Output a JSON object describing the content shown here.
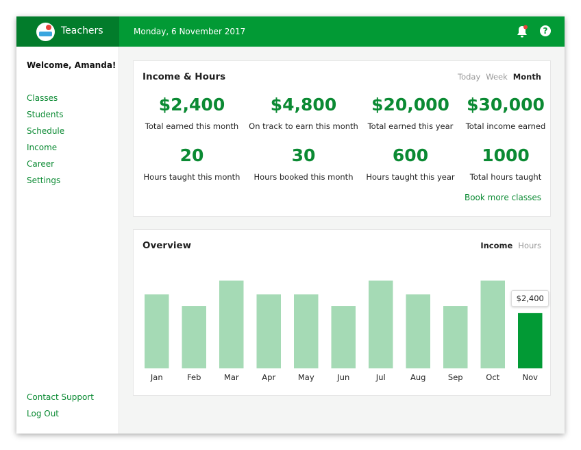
{
  "app": {
    "title": "Teachers",
    "date": "Monday, 6 November 2017"
  },
  "icons": {
    "bell": "bell-icon",
    "help": "help-icon",
    "logo": "logo-icon"
  },
  "colors": {
    "brand_dark": "#027c2b",
    "brand": "#029a35",
    "accent_text": "#0b8a33",
    "bar_light": "#a5dab5",
    "bar_active": "#029a35"
  },
  "help_glyph": "?",
  "sidebar": {
    "welcome": "Welcome, Amanda!",
    "items": [
      {
        "label": "Classes"
      },
      {
        "label": "Students"
      },
      {
        "label": "Schedule"
      },
      {
        "label": "Income"
      },
      {
        "label": "Career"
      },
      {
        "label": "Settings"
      }
    ],
    "bottom": [
      {
        "label": "Contact Support"
      },
      {
        "label": "Log Out"
      }
    ]
  },
  "income_hours": {
    "title": "Income & Hours",
    "periods": [
      {
        "label": "Today",
        "active": false
      },
      {
        "label": "Week",
        "active": false
      },
      {
        "label": "Month",
        "active": true
      }
    ],
    "stats": [
      {
        "value": "$2,400",
        "label": "Total earned this month"
      },
      {
        "value": "$4,800",
        "label": "On track to earn this month"
      },
      {
        "value": "$20,000",
        "label": "Total earned this year"
      },
      {
        "value": "$30,000",
        "label": "Total income earned"
      },
      {
        "value": "20",
        "label": "Hours taught this month"
      },
      {
        "value": "30",
        "label": "Hours booked this month"
      },
      {
        "value": "600",
        "label": "Hours taught this year"
      },
      {
        "value": "1000",
        "label": "Total hours taught"
      }
    ],
    "book_link": "Book more classes"
  },
  "overview": {
    "title": "Overview",
    "toggles": [
      {
        "label": "Income",
        "active": true
      },
      {
        "label": "Hours",
        "active": false
      }
    ],
    "tooltip": "$2,400"
  },
  "chart_data": {
    "type": "bar",
    "title": "",
    "xlabel": "",
    "ylabel": "",
    "categories": [
      "Jan",
      "Feb",
      "Mar",
      "Apr",
      "May",
      "Jun",
      "Jul",
      "Aug",
      "Sep",
      "Oct",
      "Nov"
    ],
    "values": [
      3200,
      2700,
      3800,
      3200,
      3200,
      2700,
      3800,
      3200,
      2700,
      3800,
      2400
    ],
    "highlight": "Nov",
    "ylim": [
      0,
      3800
    ],
    "grid": false
  }
}
